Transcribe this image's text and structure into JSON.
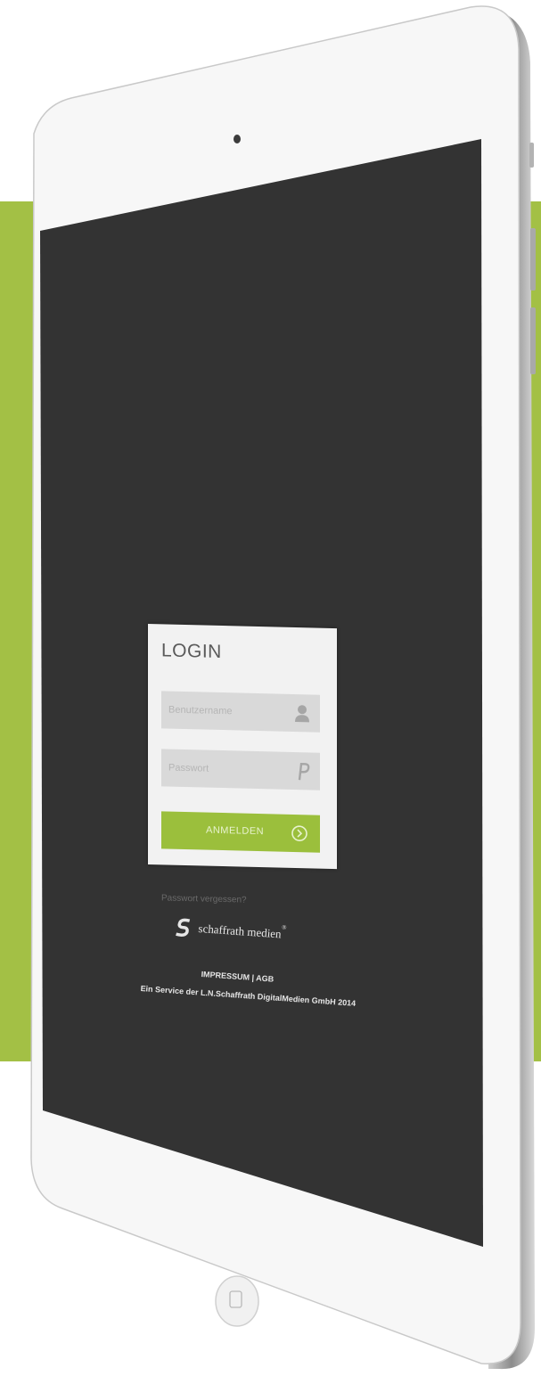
{
  "login": {
    "title": "LOGIN",
    "username_placeholder": "Benutzername",
    "password_placeholder": "Passwort",
    "submit_label": "ANMELDEN",
    "forgot_label": "Passwort vergessen?"
  },
  "branding": {
    "company": "schaffrath medien",
    "trademark": "®"
  },
  "footer": {
    "impressum": "IMPRESSUM",
    "separator": "|",
    "agb": "AGB",
    "copyright": "Ein Service der L.N.Schaffrath DigitalMedien GmbH 2014"
  },
  "colors": {
    "background_band": "#a3c045",
    "screen": "#333333",
    "accent": "#9bbf3c"
  },
  "icons": {
    "username": "user-icon",
    "password": "key-p-icon",
    "submit": "arrow-circle-icon",
    "home": "home-button-icon",
    "camera": "camera-icon"
  }
}
